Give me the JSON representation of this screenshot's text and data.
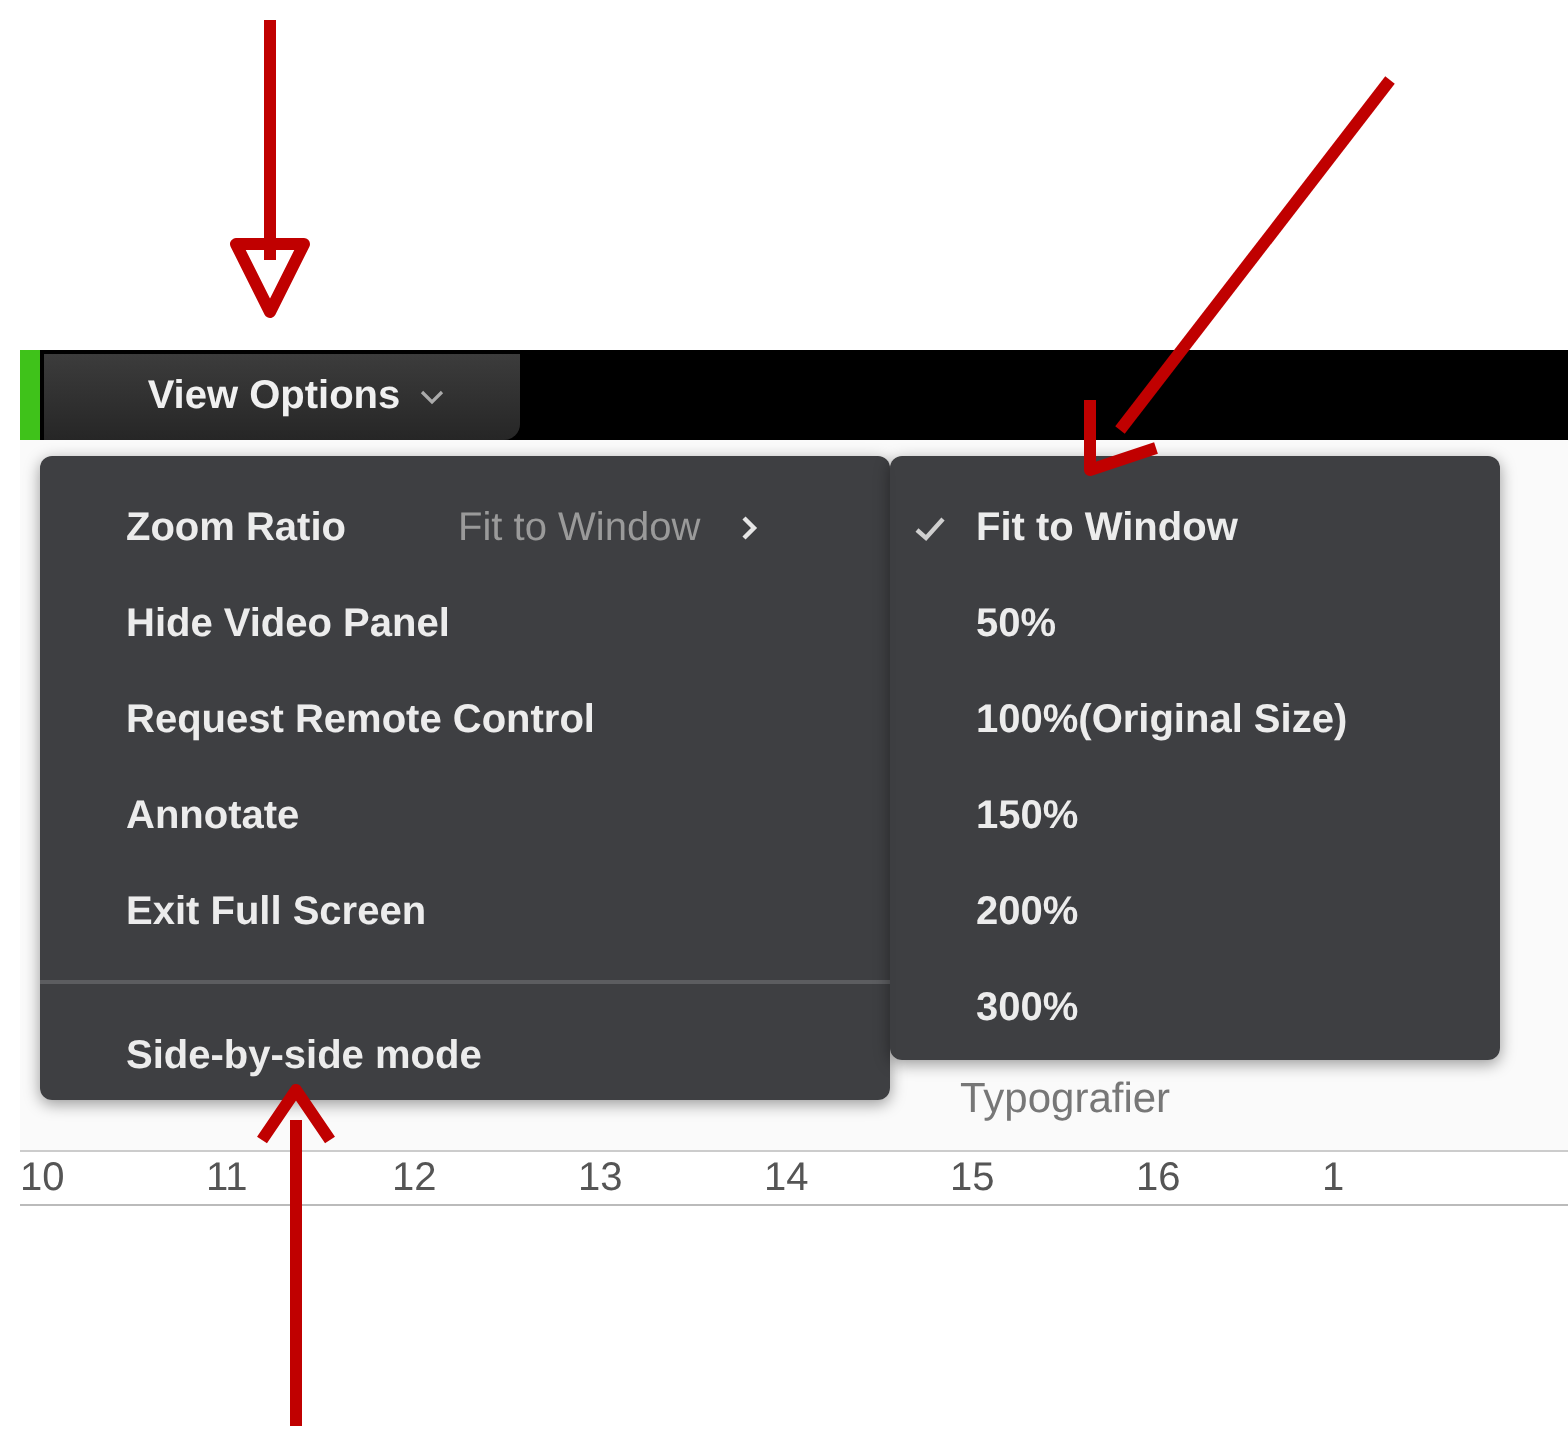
{
  "toolbar": {
    "view_options": {
      "label": "View Options",
      "expanded": true
    }
  },
  "document": {
    "ribbon_group": "Typografier",
    "ruler_numbers": [
      "10",
      "11",
      "12",
      "13",
      "14",
      "15",
      "16",
      "1"
    ]
  },
  "menu": {
    "items": [
      {
        "kind": "submenu",
        "label": "Zoom Ratio",
        "value": "Fit to Window"
      },
      {
        "kind": "item",
        "label": "Hide Video Panel"
      },
      {
        "kind": "item",
        "label": "Request Remote Control"
      },
      {
        "kind": "item",
        "label": "Annotate"
      },
      {
        "kind": "item",
        "label": "Exit Full Screen"
      },
      {
        "kind": "separator"
      },
      {
        "kind": "item",
        "label": "Side-by-side mode"
      }
    ]
  },
  "submenu": {
    "items": [
      {
        "label": "Fit to Window",
        "selected": true
      },
      {
        "label": "50%",
        "selected": false
      },
      {
        "label": "100%(Original Size)",
        "selected": false
      },
      {
        "label": "150%",
        "selected": false
      },
      {
        "label": "200%",
        "selected": false
      },
      {
        "label": "300%",
        "selected": false
      }
    ]
  }
}
